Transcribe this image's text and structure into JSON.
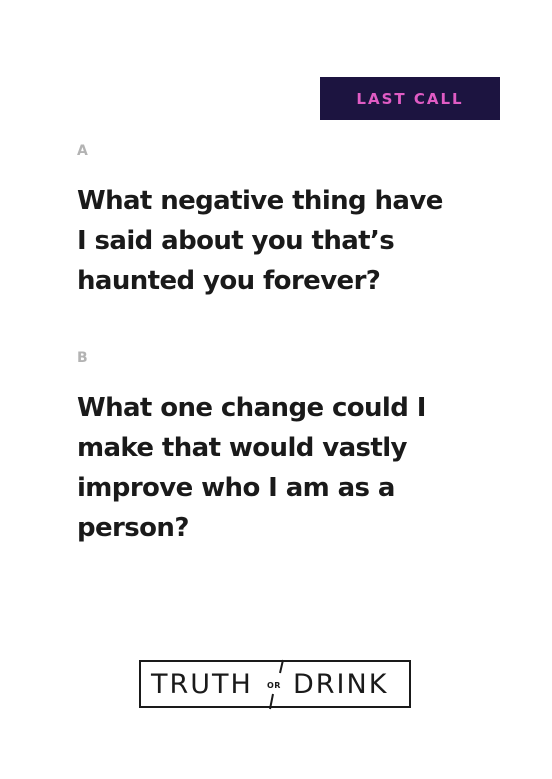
{
  "badge": {
    "label": "LAST CALL"
  },
  "options": [
    {
      "letter": "A",
      "question": "What negative thing have I said about you that’s haunted you forever?"
    },
    {
      "letter": "B",
      "question": "What one change could I make that would vastly improve who I am as a person?"
    }
  ],
  "logo": {
    "left_word": "TRUTH",
    "connector": "OR",
    "right_word": "DRINK"
  },
  "colors": {
    "badge_background": "#1c1440",
    "badge_text": "#e05cc4",
    "question_text": "#1a1a1a",
    "letter_text": "#b3b3b3",
    "logo_ink": "#1a1a1a"
  }
}
